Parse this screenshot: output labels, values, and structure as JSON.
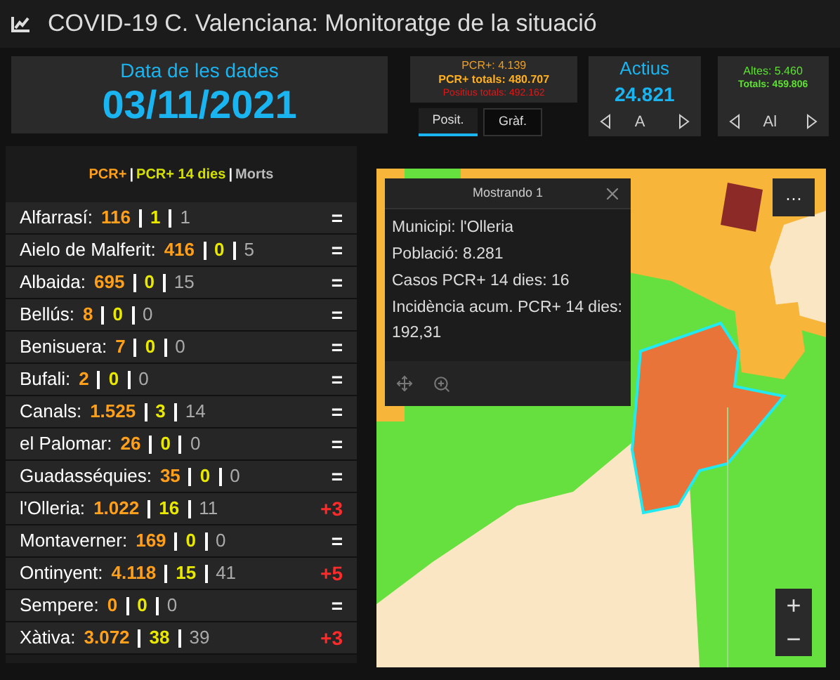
{
  "window": {
    "title": "COVID-19 C. Valenciana: Monitoratge de la situació"
  },
  "date_panel": {
    "label": "Data de les dades",
    "value": "03/11/2021"
  },
  "totals_panel": {
    "pcr": "PCR+: 4.139",
    "pcr_total": "PCR+ totals: 480.707",
    "positive_total": "Positius totals: 492.162"
  },
  "view_tabs": [
    {
      "label": "Posit.",
      "selected": true
    },
    {
      "label": "Gràf.",
      "selected": false
    }
  ],
  "active_panel": {
    "label": "Actius",
    "value": "24.821",
    "pager": "A"
  },
  "discharge_panel": {
    "discharged": "Altes: 5.460",
    "total": "Totals: 459.806",
    "pager": "Al"
  },
  "list_header": {
    "pcr": "PCR+",
    "separator_1": "|",
    "pcr14": "PCR+ 14 dies",
    "separator_2": "|",
    "deaths": "Morts"
  },
  "municipalities": [
    {
      "name": "Alfarrasí:",
      "pcr": "116",
      "pcr14": "1",
      "deaths": "1",
      "change": "=",
      "kind": "same"
    },
    {
      "name": "Aielo de Malferit:",
      "pcr": "416",
      "pcr14": "0",
      "deaths": "5",
      "change": "=",
      "kind": "same"
    },
    {
      "name": "Albaida:",
      "pcr": "695",
      "pcr14": "0",
      "deaths": "15",
      "change": "=",
      "kind": "same"
    },
    {
      "name": "Bellús:",
      "pcr": "8",
      "pcr14": "0",
      "deaths": "0",
      "change": "=",
      "kind": "same"
    },
    {
      "name": "Benisuera:",
      "pcr": "7",
      "pcr14": "0",
      "deaths": "0",
      "change": "=",
      "kind": "same"
    },
    {
      "name": "Bufali:",
      "pcr": "2",
      "pcr14": "0",
      "deaths": "0",
      "change": "=",
      "kind": "same"
    },
    {
      "name": "Canals:",
      "pcr": "1.525",
      "pcr14": "3",
      "deaths": "14",
      "change": "=",
      "kind": "same"
    },
    {
      "name": "el Palomar:",
      "pcr": "26",
      "pcr14": "0",
      "deaths": "0",
      "change": "=",
      "kind": "same"
    },
    {
      "name": "Guadasséquies:",
      "pcr": "35",
      "pcr14": "0",
      "deaths": "0",
      "change": "=",
      "kind": "same"
    },
    {
      "name": "l'Olleria:",
      "pcr": "1.022",
      "pcr14": "16",
      "deaths": "11",
      "change": "+3",
      "kind": "increase"
    },
    {
      "name": "Montaverner:",
      "pcr": "169",
      "pcr14": "0",
      "deaths": "0",
      "change": "=",
      "kind": "same"
    },
    {
      "name": "Ontinyent:",
      "pcr": "4.118",
      "pcr14": "15",
      "deaths": "41",
      "change": "+5",
      "kind": "increase"
    },
    {
      "name": "Sempere:",
      "pcr": "0",
      "pcr14": "0",
      "deaths": "0",
      "change": "=",
      "kind": "same"
    },
    {
      "name": "Xàtiva:",
      "pcr": "3.072",
      "pcr14": "38",
      "deaths": "39",
      "change": "+3",
      "kind": "increase"
    }
  ],
  "map": {
    "kind": "picture",
    "popup": {
      "title": "Mostrando 1",
      "lines": [
        "Municipi: l'Olleria",
        "Població: 8.281",
        "Casos PCR+ 14 dies: 16",
        "Incidència acum. PCR+ 14 dies: 192,31"
      ]
    },
    "more_button": "···",
    "zoom_in": "+",
    "zoom_out": "−"
  }
}
